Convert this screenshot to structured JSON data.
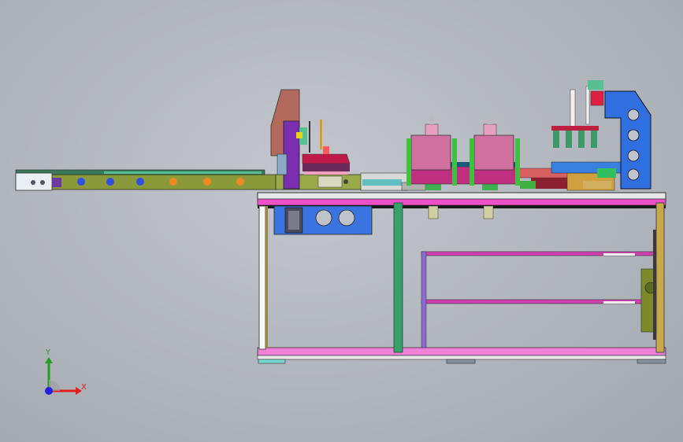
{
  "viewport": {
    "background": "#b8bcc2",
    "model": "automated-assembly-machine"
  },
  "triad": {
    "x_label": "X",
    "y_label": "Y",
    "x_color": "#e02020",
    "y_color": "#20a020",
    "z_color": "#2020e0"
  },
  "colors": {
    "frame_pink": "#f04fc8",
    "frame_green": "#3aa06a",
    "olive": "#8a9a3a",
    "blue": "#2f6fe0",
    "purple": "#7a2fb0",
    "brown": "#b06a5a",
    "pink_module": "#d070a0"
  }
}
